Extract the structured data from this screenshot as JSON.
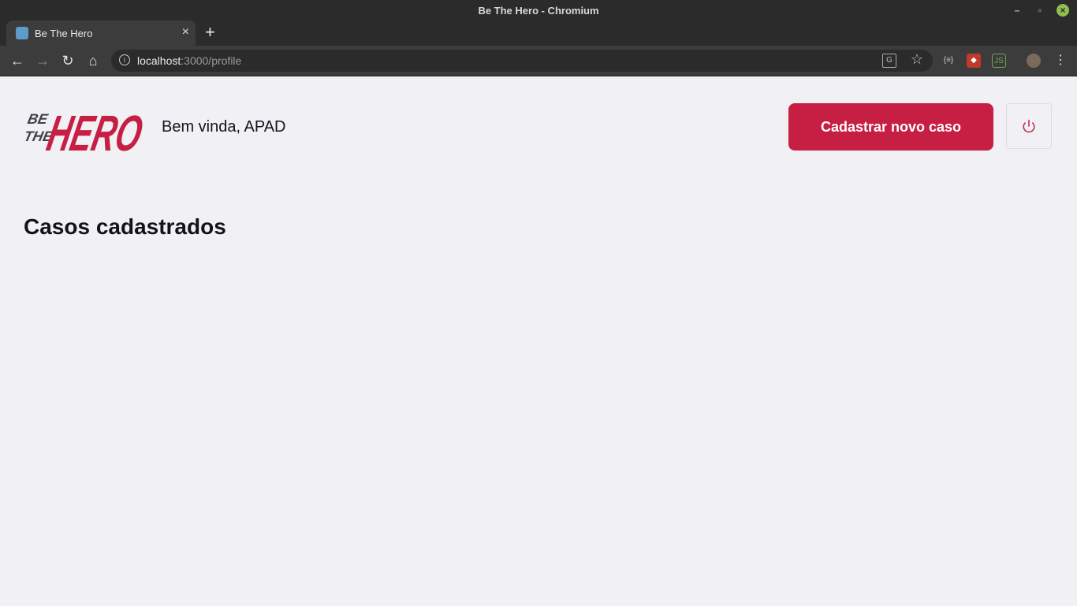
{
  "window": {
    "title": "Be The Hero - Chromium"
  },
  "tab": {
    "label": "Be The Hero"
  },
  "omnibox": {
    "host": "localhost",
    "path": ":3000/profile"
  },
  "header": {
    "welcome": "Bem vinda, APAD",
    "cta_label": "Cadastrar novo caso"
  },
  "main": {
    "heading": "Casos cadastrados"
  },
  "colors": {
    "brand": "#c71f43",
    "background": "#f0f0f5",
    "text": "#13131a"
  },
  "icons": [
    "react-favicon-icon",
    "back-arrow-icon",
    "forward-arrow-icon",
    "reload-icon",
    "home-icon",
    "info-icon",
    "translate-icon",
    "star-icon",
    "extension-icon",
    "profile-avatar-icon",
    "menu-dots-icon",
    "power-icon"
  ]
}
